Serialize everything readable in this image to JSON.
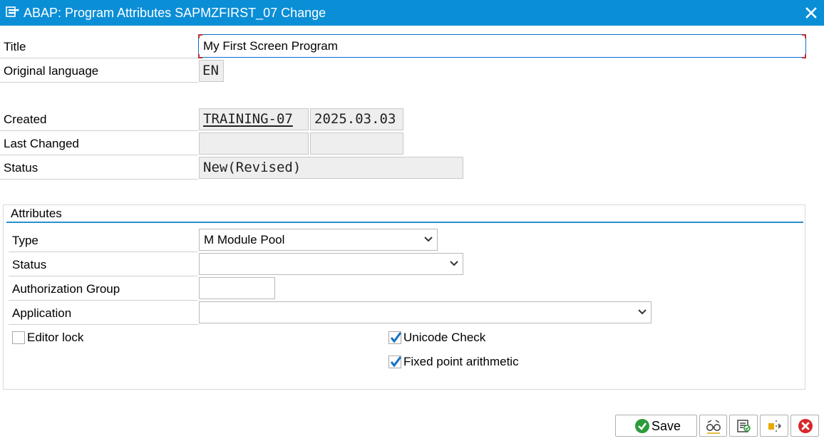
{
  "window": {
    "title": "ABAP: Program Attributes SAPMZFIRST_07 Change",
    "close_icon": "close-icon",
    "app_icon": "program-icon"
  },
  "header_fields": {
    "title_label": "Title",
    "title_value": "My First Screen Program",
    "original_language_label": "Original language",
    "original_language_value": "EN",
    "created_label": "Created",
    "created_user": "TRAINING-07",
    "created_date": "2025.03.03",
    "last_changed_label": "Last Changed",
    "last_changed_user": "",
    "last_changed_date": "",
    "status_label": "Status",
    "status_value": "New(Revised)"
  },
  "attributes": {
    "group_title": "Attributes",
    "type_label": "Type",
    "type_value": "M Module Pool",
    "status_label": "Status",
    "status_value": "",
    "authorization_group_label": "Authorization Group",
    "authorization_group_value": "",
    "application_label": "Application",
    "application_value": "",
    "editor_lock_label": "Editor lock",
    "editor_lock_checked": false,
    "unicode_check_label": "Unicode Check",
    "unicode_check_checked": true,
    "fixed_point_label": "Fixed point arithmetic",
    "fixed_point_checked": true
  },
  "footer": {
    "save_label": "Save",
    "buttons": [
      "save-icon",
      "display-glasses-icon",
      "check-icon",
      "transport-icon",
      "cancel-icon"
    ]
  },
  "colors": {
    "titlebar": "#0a8ed6",
    "group_line": "#2a8fcc",
    "checkbox_tick": "#1a6fc4",
    "save_green": "#2e9b3b",
    "cancel_red": "#d9262b",
    "focus_corner": "#c0303a"
  }
}
